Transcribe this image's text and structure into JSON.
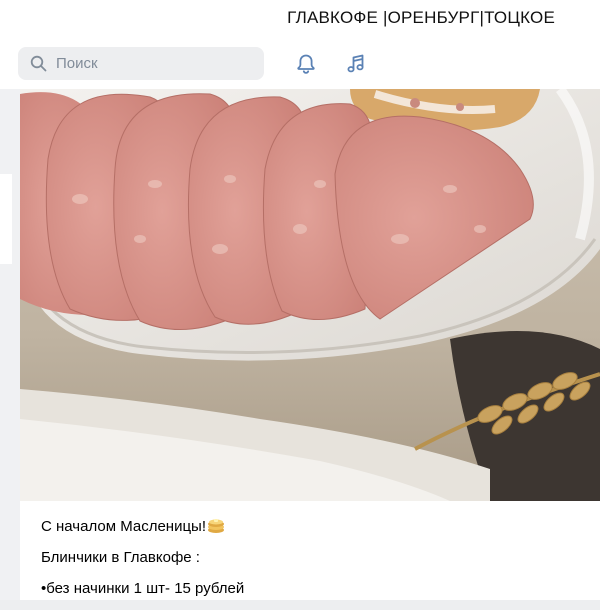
{
  "header": {
    "title": "ГЛАВКОФЕ |ОРЕНБУРГ|ТОЦКОЕ"
  },
  "search": {
    "placeholder": "Поиск",
    "icon": "search-icon"
  },
  "toolbar": {
    "icons": [
      "bell-icon",
      "music-note-icon"
    ]
  },
  "post": {
    "photo_icon": "sausage-plate-photo",
    "lines": [
      "С началом Масленицы!",
      "Блинчики в Главкофе :",
      "•без начинки 1 шт- 15 рублей"
    ],
    "emoji": "pancakes-emoji"
  },
  "colors": {
    "background": "#edeef0",
    "accent_icon": "#5b82b5",
    "placeholder": "#818c99"
  }
}
